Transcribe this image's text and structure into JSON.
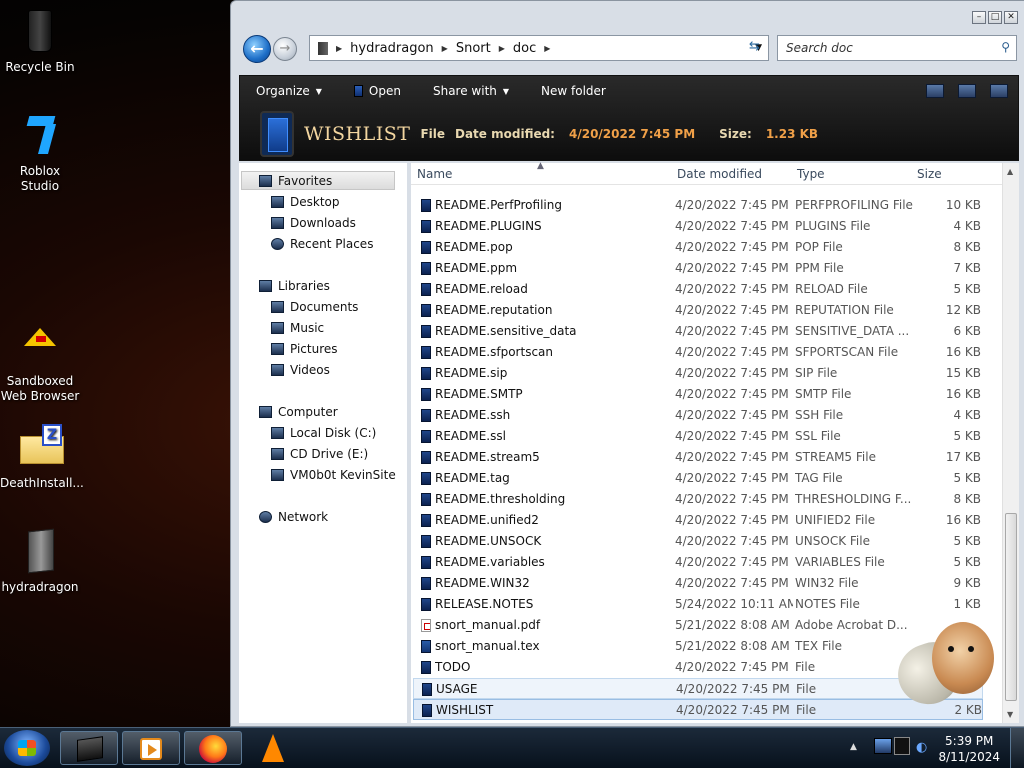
{
  "desktop": {
    "icons": [
      {
        "label": "Recycle Bin"
      },
      {
        "label": "Roblox Studio"
      },
      {
        "label": "Sandboxed Web Browser"
      },
      {
        "label": "DeathInstall..."
      },
      {
        "label": "hydradragon"
      }
    ]
  },
  "window": {
    "address": {
      "crumbs": [
        "hydradragon",
        "Snort",
        "doc"
      ]
    },
    "search": {
      "placeholder": "Search doc"
    },
    "toolbar": {
      "organize": "Organize",
      "open": "Open",
      "share_with": "Share with",
      "new_folder": "New folder"
    },
    "details": {
      "file_name": "WISHLIST",
      "file_type": "File",
      "date_label": "Date modified:",
      "date_value": "4/20/2022 7:45 PM",
      "size_label": "Size:",
      "size_value": "1.23 KB"
    },
    "nav": {
      "favorites": "Favorites",
      "desktop": "Desktop",
      "downloads": "Downloads",
      "recent_places": "Recent Places",
      "libraries": "Libraries",
      "documents": "Documents",
      "music": "Music",
      "pictures": "Pictures",
      "videos": "Videos",
      "computer": "Computer",
      "local_disk": "Local Disk (C:)",
      "cd_drive": "CD Drive (E:)",
      "vm_site": "VM0b0t KevinSite",
      "network": "Network"
    },
    "columns": {
      "name": "Name",
      "date": "Date modified",
      "type": "Type",
      "size": "Size"
    },
    "files": [
      {
        "name": "README.PerfProfiling",
        "date": "4/20/2022 7:45 PM",
        "type": "PERFPROFILING File",
        "size": "10 KB"
      },
      {
        "name": "README.PLUGINS",
        "date": "4/20/2022 7:45 PM",
        "type": "PLUGINS File",
        "size": "4 KB"
      },
      {
        "name": "README.pop",
        "date": "4/20/2022 7:45 PM",
        "type": "POP File",
        "size": "8 KB"
      },
      {
        "name": "README.ppm",
        "date": "4/20/2022 7:45 PM",
        "type": "PPM File",
        "size": "7 KB"
      },
      {
        "name": "README.reload",
        "date": "4/20/2022 7:45 PM",
        "type": "RELOAD File",
        "size": "5 KB"
      },
      {
        "name": "README.reputation",
        "date": "4/20/2022 7:45 PM",
        "type": "REPUTATION File",
        "size": "12 KB"
      },
      {
        "name": "README.sensitive_data",
        "date": "4/20/2022 7:45 PM",
        "type": "SENSITIVE_DATA ...",
        "size": "6 KB"
      },
      {
        "name": "README.sfportscan",
        "date": "4/20/2022 7:45 PM",
        "type": "SFPORTSCAN File",
        "size": "16 KB"
      },
      {
        "name": "README.sip",
        "date": "4/20/2022 7:45 PM",
        "type": "SIP File",
        "size": "15 KB"
      },
      {
        "name": "README.SMTP",
        "date": "4/20/2022 7:45 PM",
        "type": "SMTP File",
        "size": "16 KB"
      },
      {
        "name": "README.ssh",
        "date": "4/20/2022 7:45 PM",
        "type": "SSH File",
        "size": "4 KB"
      },
      {
        "name": "README.ssl",
        "date": "4/20/2022 7:45 PM",
        "type": "SSL File",
        "size": "5 KB"
      },
      {
        "name": "README.stream5",
        "date": "4/20/2022 7:45 PM",
        "type": "STREAM5 File",
        "size": "17 KB"
      },
      {
        "name": "README.tag",
        "date": "4/20/2022 7:45 PM",
        "type": "TAG File",
        "size": "5 KB"
      },
      {
        "name": "README.thresholding",
        "date": "4/20/2022 7:45 PM",
        "type": "THRESHOLDING F...",
        "size": "8 KB"
      },
      {
        "name": "README.unified2",
        "date": "4/20/2022 7:45 PM",
        "type": "UNIFIED2 File",
        "size": "16 KB"
      },
      {
        "name": "README.UNSOCK",
        "date": "4/20/2022 7:45 PM",
        "type": "UNSOCK File",
        "size": "5 KB"
      },
      {
        "name": "README.variables",
        "date": "4/20/2022 7:45 PM",
        "type": "VARIABLES File",
        "size": "5 KB"
      },
      {
        "name": "README.WIN32",
        "date": "4/20/2022 7:45 PM",
        "type": "WIN32 File",
        "size": "9 KB"
      },
      {
        "name": "RELEASE.NOTES",
        "date": "5/24/2022 10:11 AM",
        "type": "NOTES File",
        "size": "1 KB"
      },
      {
        "name": "snort_manual.pdf",
        "date": "5/21/2022 8:08 AM",
        "type": "Adobe Acrobat D...",
        "size": ""
      },
      {
        "name": "snort_manual.tex",
        "date": "5/21/2022 8:08 AM",
        "type": "TEX File",
        "size": ""
      },
      {
        "name": "TODO",
        "date": "4/20/2022 7:45 PM",
        "type": "File",
        "size": ""
      },
      {
        "name": "USAGE",
        "date": "4/20/2022 7:45 PM",
        "type": "File",
        "size": ""
      },
      {
        "name": "WISHLIST",
        "date": "4/20/2022 7:45 PM",
        "type": "File",
        "size": "2 KB"
      }
    ]
  },
  "taskbar": {
    "time": "5:39 PM",
    "date": "8/11/2024"
  }
}
